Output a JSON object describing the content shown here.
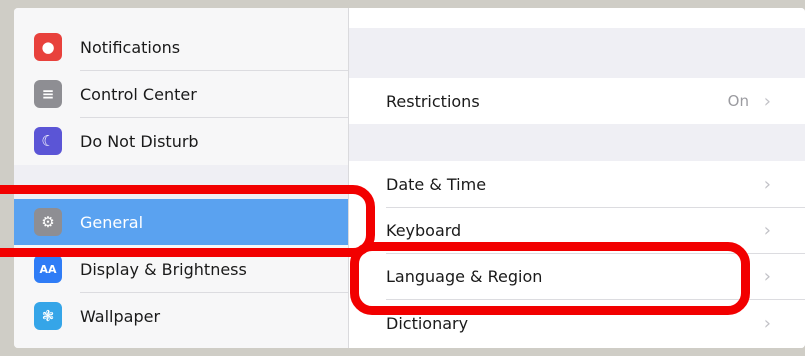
{
  "sidebar": {
    "items": [
      {
        "label": "Notifications",
        "icon": "notifications-icon",
        "color": "#e8413c",
        "glyph": "●"
      },
      {
        "label": "Control Center",
        "icon": "control-center-icon",
        "color": "#8e8e93",
        "glyph": "≡"
      },
      {
        "label": "Do Not Disturb",
        "icon": "moon-icon",
        "color": "#5b55d6",
        "glyph": "☾"
      },
      {
        "label": "General",
        "icon": "gear-icon",
        "color": "#8e8e93",
        "glyph": "⚙"
      },
      {
        "label": "Display & Brightness",
        "icon": "display-brightness-icon",
        "color": "#2f7cf6",
        "glyph": "AA"
      },
      {
        "label": "Wallpaper",
        "icon": "wallpaper-icon",
        "color": "#35a5e8",
        "glyph": "❃"
      }
    ],
    "selected": "General"
  },
  "detail": {
    "restrictions": {
      "label": "Restrictions",
      "value": "On"
    },
    "items": [
      {
        "label": "Date & Time"
      },
      {
        "label": "Keyboard"
      },
      {
        "label": "Language & Region"
      },
      {
        "label": "Dictionary"
      }
    ]
  },
  "colors": {
    "selection": "#5aa2f0",
    "annotation": "#f20000"
  }
}
